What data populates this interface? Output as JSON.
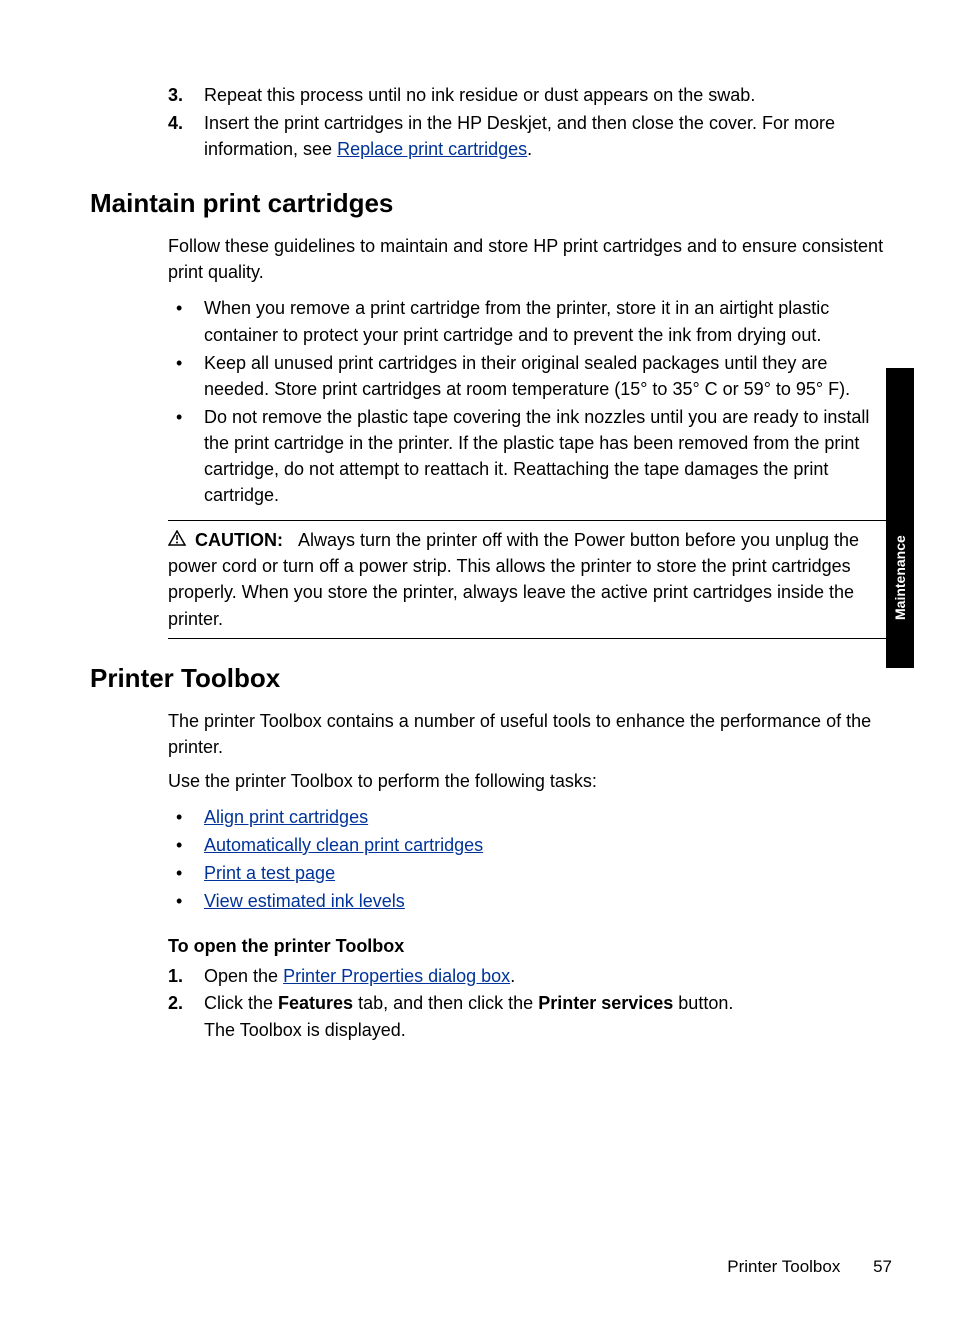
{
  "topSteps": {
    "s3_num": "3.",
    "s3_text": "Repeat this process until no ink residue or dust appears on the swab.",
    "s4_num": "4.",
    "s4_text_a": "Insert the print cartridges in the HP Deskjet, and then close the cover. For more information, see ",
    "s4_link": "Replace print cartridges",
    "s4_text_b": "."
  },
  "section1": {
    "heading": "Maintain print cartridges",
    "intro": "Follow these guidelines to maintain and store HP print cartridges and to ensure consistent print quality.",
    "b1": "When you remove a print cartridge from the printer, store it in an airtight plastic container to protect your print cartridge and to prevent the ink from drying out.",
    "b2": "Keep all unused print cartridges in their original sealed packages until they are needed. Store print cartridges at room temperature (15° to 35° C or 59° to 95° F).",
    "b3": "Do not remove the plastic tape covering the ink nozzles until you are ready to install the print cartridge in the printer. If the plastic tape has been removed from the print cartridge, do not attempt to reattach it. Reattaching the tape damages the print cartridge.",
    "caution_label": "CAUTION:",
    "caution_text": "Always turn the printer off with the Power button before you unplug the power cord or turn off a power strip. This allows the printer to store the print cartridges properly. When you store the printer, always leave the active print cartridges inside the printer."
  },
  "section2": {
    "heading": "Printer Toolbox",
    "p1": "The printer Toolbox contains a number of useful tools to enhance the performance of the printer.",
    "p2": "Use the printer Toolbox to perform the following tasks:",
    "links": {
      "l1": "Align print cartridges",
      "l2": "Automatically clean print cartridges",
      "l3": "Print a test page",
      "l4": "View estimated ink levels"
    },
    "subhead": "To open the printer Toolbox",
    "step1_num": "1.",
    "step1_a": "Open the ",
    "step1_link": "Printer Properties dialog box",
    "step1_b": ".",
    "step2_num": "2.",
    "step2_a": "Click the ",
    "step2_bold1": "Features",
    "step2_b": " tab, and then click the ",
    "step2_bold2": "Printer services",
    "step2_c": " button.",
    "step2_line2": "The Toolbox is displayed."
  },
  "sideTab": "Maintenance",
  "footer": {
    "title": "Printer Toolbox",
    "page": "57"
  }
}
